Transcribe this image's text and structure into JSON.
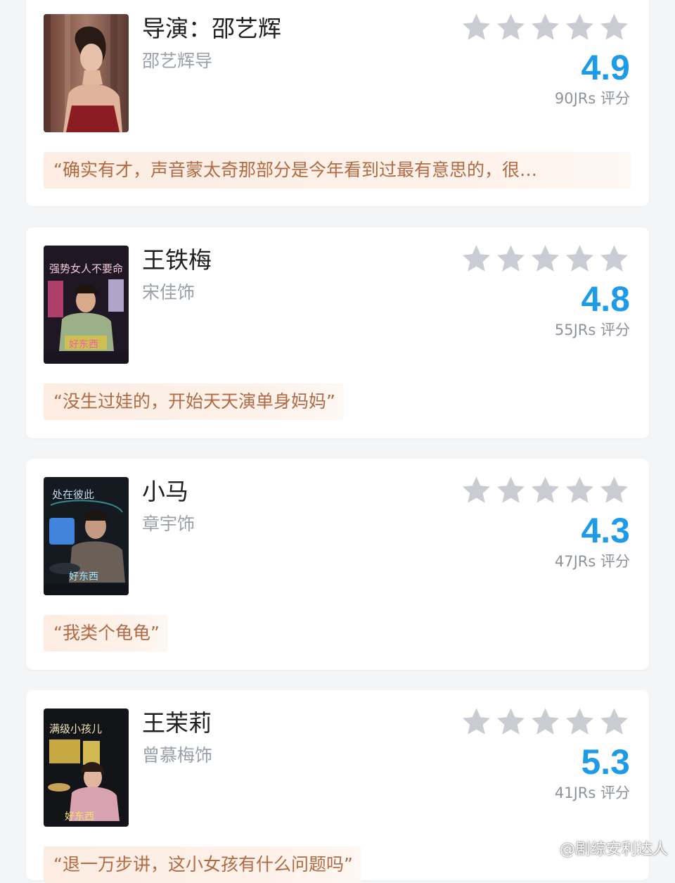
{
  "colors": {
    "score": "#1e9be8",
    "star_empty": "#c9ccd2",
    "comment_bg": "#fcece1",
    "comment_text": "#b26a45",
    "page_bg": "#f4f5f7"
  },
  "cards": [
    {
      "name": "导演：邵艺辉",
      "role": "邵艺辉导",
      "score": "4.9",
      "count": "90JRs 评分",
      "comment": "“确实有才，声音蒙太奇那部分是今年看到过最有意思的，很…"
    },
    {
      "name": "王铁梅",
      "role": "宋佳饰",
      "score": "4.8",
      "count": "55JRs 评分",
      "comment": "“没生过娃的，开始天天演单身妈妈”"
    },
    {
      "name": "小马",
      "role": "章宇饰",
      "score": "4.3",
      "count": "47JRs 评分",
      "comment": "“我类个龟龟”"
    },
    {
      "name": "王茉莉",
      "role": "曾慕梅饰",
      "score": "5.3",
      "count": "41JRs 评分",
      "comment": "“退一万步讲，这小女孩有什么问题吗”"
    }
  ],
  "watermark": "@剧综安利达人"
}
